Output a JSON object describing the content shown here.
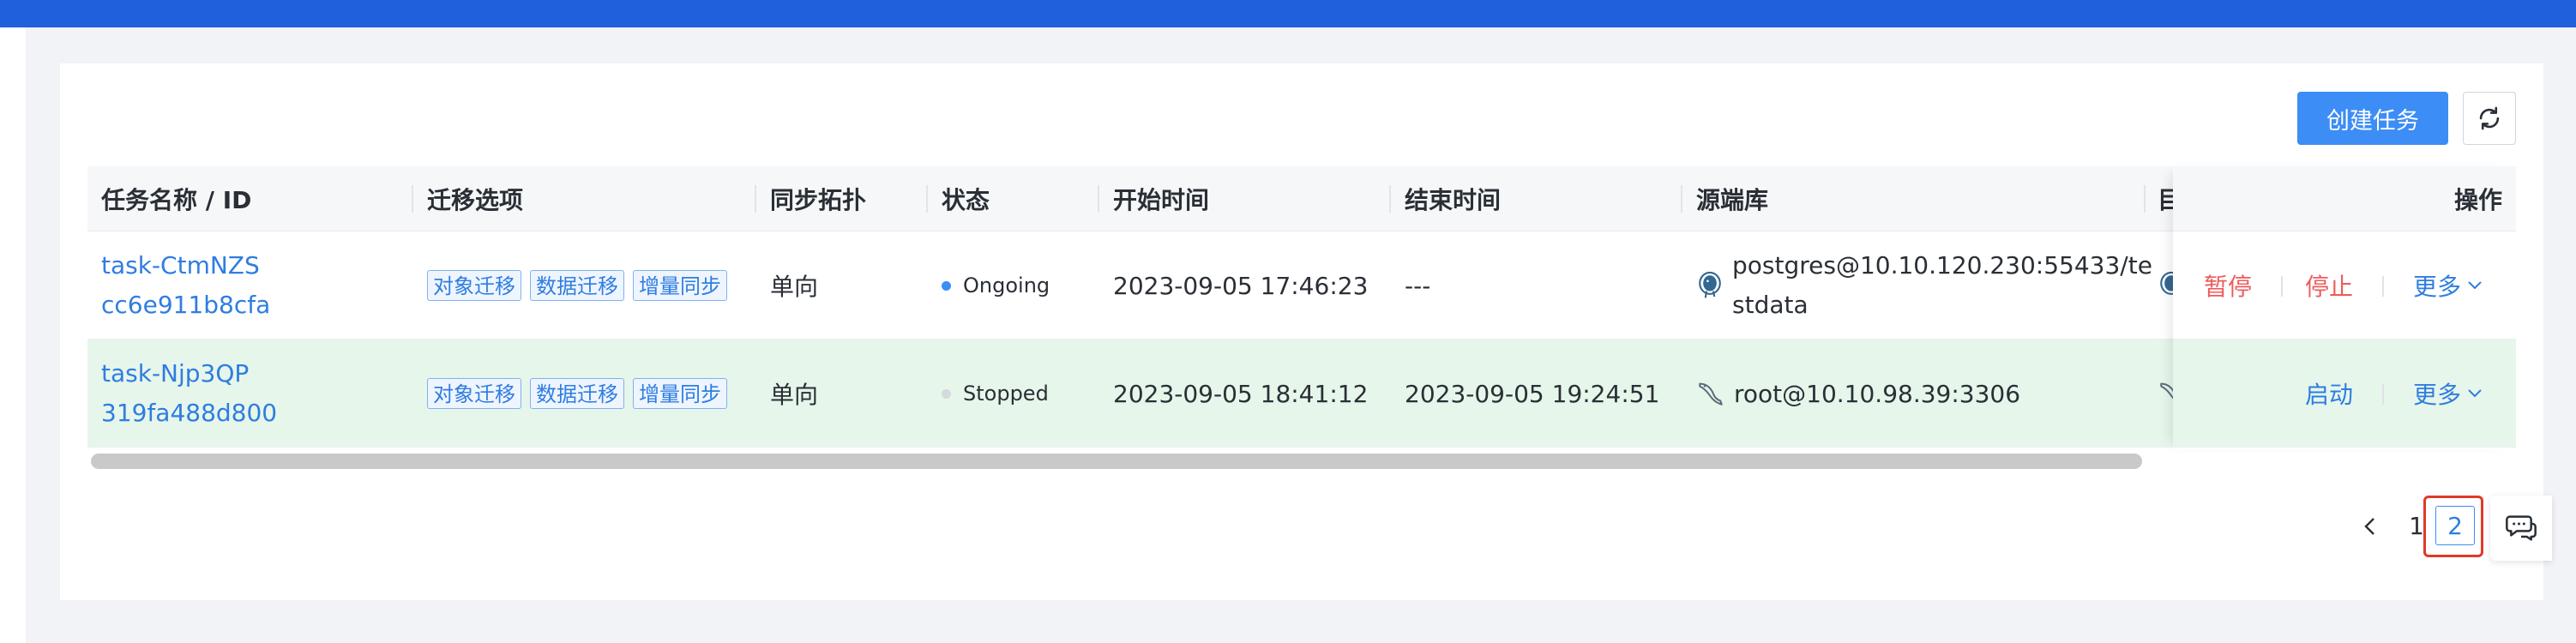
{
  "toolbar": {
    "create_label": "创建任务"
  },
  "table": {
    "columns": {
      "name": "任务名称 / ID",
      "options": "迁移选项",
      "topology": "同步拓扑",
      "status": "状态",
      "start": "开始时间",
      "end": "结束时间",
      "source": "源端库",
      "target_partial": "目",
      "ops": "操作"
    },
    "rows": [
      {
        "name": "task-CtmNZS",
        "id": "cc6e911b8cfa",
        "tags": [
          "对象迁移",
          "数据迁移",
          "增量同步"
        ],
        "topology": "单向",
        "status": "Ongoing",
        "status_color": "#3c8df5",
        "start": "2023-09-05 17:46:23",
        "end": "---",
        "source_line1": "postgres@10.10.120.230:55433/te",
        "source_line2": "stdata",
        "source_icon": "postgresql-icon",
        "ops": [
          "暂停",
          "停止",
          "更多"
        ]
      },
      {
        "name": "task-Njp3QP",
        "id": "319fa488d800",
        "tags": [
          "对象迁移",
          "数据迁移",
          "增量同步"
        ],
        "topology": "单向",
        "status": "Stopped",
        "status_color": "#d5d8dd",
        "start": "2023-09-05 18:41:12",
        "end": "2023-09-05 19:24:51",
        "source_line1": "root@10.10.98.39:3306",
        "source_icon": "mysql-icon",
        "ops": [
          "启动",
          "更多"
        ]
      }
    ]
  },
  "pagination": {
    "page1": "1",
    "page2": "2",
    "current": 2
  },
  "colors": {
    "accent": "#3c8df5",
    "link": "#2f7de1",
    "danger": "#ef5b5b",
    "highlight_row": "#e6f6ea",
    "topbar": "#2060dc"
  }
}
